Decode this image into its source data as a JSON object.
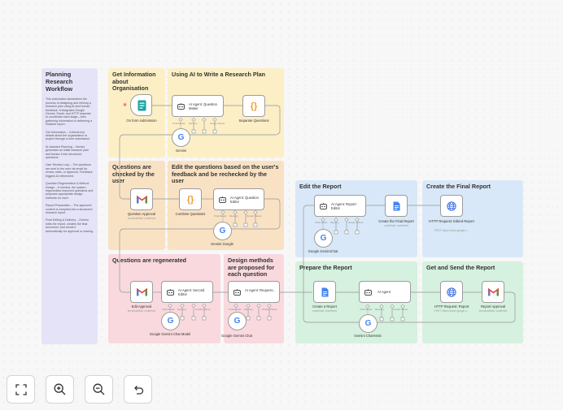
{
  "note": {
    "title": "Planning Research Workflow",
    "paragraphs": [
      "This automation streamlines the process of designing and refining a research plan using AI and human feedback. It integrates Google Gemini, Gmail, and HTTP requests to coordinate each stage—from gathering information to delivering a finalized report.",
      "Get Information – Collects key details about the organization or project through a form submission.",
      "AI Assisted Planning – Gemini generates an initial research plan and breaks it into structured questions.",
      "User Review Loop – The questions are sent to the user via email for review, edits, or approval. Feedback triggers AI refinement.",
      "Question Regeneration & Method Design – If needed, the system regenerates improved questions and proposes appropriate design methods for each.",
      "Report Preparation – The approved content is compiled into a structured research report.",
      "Final Editing & Delivery – Gemini edits the report, creates the final document, and sends it automatically for approval or sharing."
    ]
  },
  "stickies": {
    "get_info": "Get Information about Organisation",
    "using_ai": "Using AI to Write a Research Plan",
    "checked": "Questions are checked by the user",
    "edit_questions": "Edit the questions based on the user's feedback and be rechecked by the user",
    "edit_report": "Edit the Report",
    "final_report": "Create the Final Report",
    "regenerated": "Questions are regenerated",
    "design_methods": "Design methods are proposed for each question",
    "prepare_report": "Prepare the Report",
    "get_send": "Get and Send the Report"
  },
  "nodes": {
    "form": {
      "title": "On form submission"
    },
    "question_maker": {
      "title": "AI Agent: Question Maker"
    },
    "separate": {
      "title": "Separate Questions"
    },
    "gemini": {
      "title": "Gemini"
    },
    "question_approval": {
      "title": "Question Approval",
      "sub": "sendAndWait: undefined"
    },
    "combine": {
      "title": "Combine Questions"
    },
    "question_editor": {
      "title": "AI Agent: Question Editor"
    },
    "gemini_google": {
      "title": "Gemini Google"
    },
    "report_editor": {
      "title": "AI Agent: Report Editor"
    },
    "create_final": {
      "title": "Create the Final Report",
      "sub": "undefined: undefined"
    },
    "google_geminichat": {
      "title": "Google GeminiChat"
    },
    "http_edited": {
      "title": "HTTP Request: Edited Report",
      "sub": "POST: https://script.google.c..."
    },
    "edit_approval": {
      "title": "Edit Approval",
      "sub": "sendAndWait: undefined"
    },
    "second_editor": {
      "title": "AI Agent: Second Editor"
    },
    "gemini_chat_model": {
      "title": "Google Gemini Chat Model"
    },
    "agent_request": {
      "title": "AI Agent: Request..."
    },
    "google_gemini_chat": {
      "title": "Google Gemini Chat"
    },
    "create_report": {
      "title": "Create a Report",
      "sub": "undefined: undefined"
    },
    "ai_agent": {
      "title": "AI Agent"
    },
    "gemini_chatassis": {
      "title": "Gemini ChatAssis"
    },
    "http_report": {
      "title": "HTTP Request: Report",
      "sub": "POST: https://script.google.c..."
    },
    "report_approval": {
      "title": "Report Approval",
      "sub": "sendAndWait: undefined"
    }
  },
  "ports": {
    "chat_model": "Chat Model",
    "memory": "Memory",
    "tool": "Tool",
    "output_parser": "Output Parser"
  },
  "controls": {
    "fit": "fit-view-icon",
    "zoom_in": "zoom-in-icon",
    "zoom_out": "zoom-out-icon",
    "reset": "undo-icon"
  },
  "colors": {
    "gmail_red": "#ea4335",
    "docs_blue": "#4285f4",
    "form_teal": "#1aa3a3",
    "code_orange": "#f29d35",
    "http_blue": "#3b6fe0",
    "canvas": "#f7f7f7"
  }
}
